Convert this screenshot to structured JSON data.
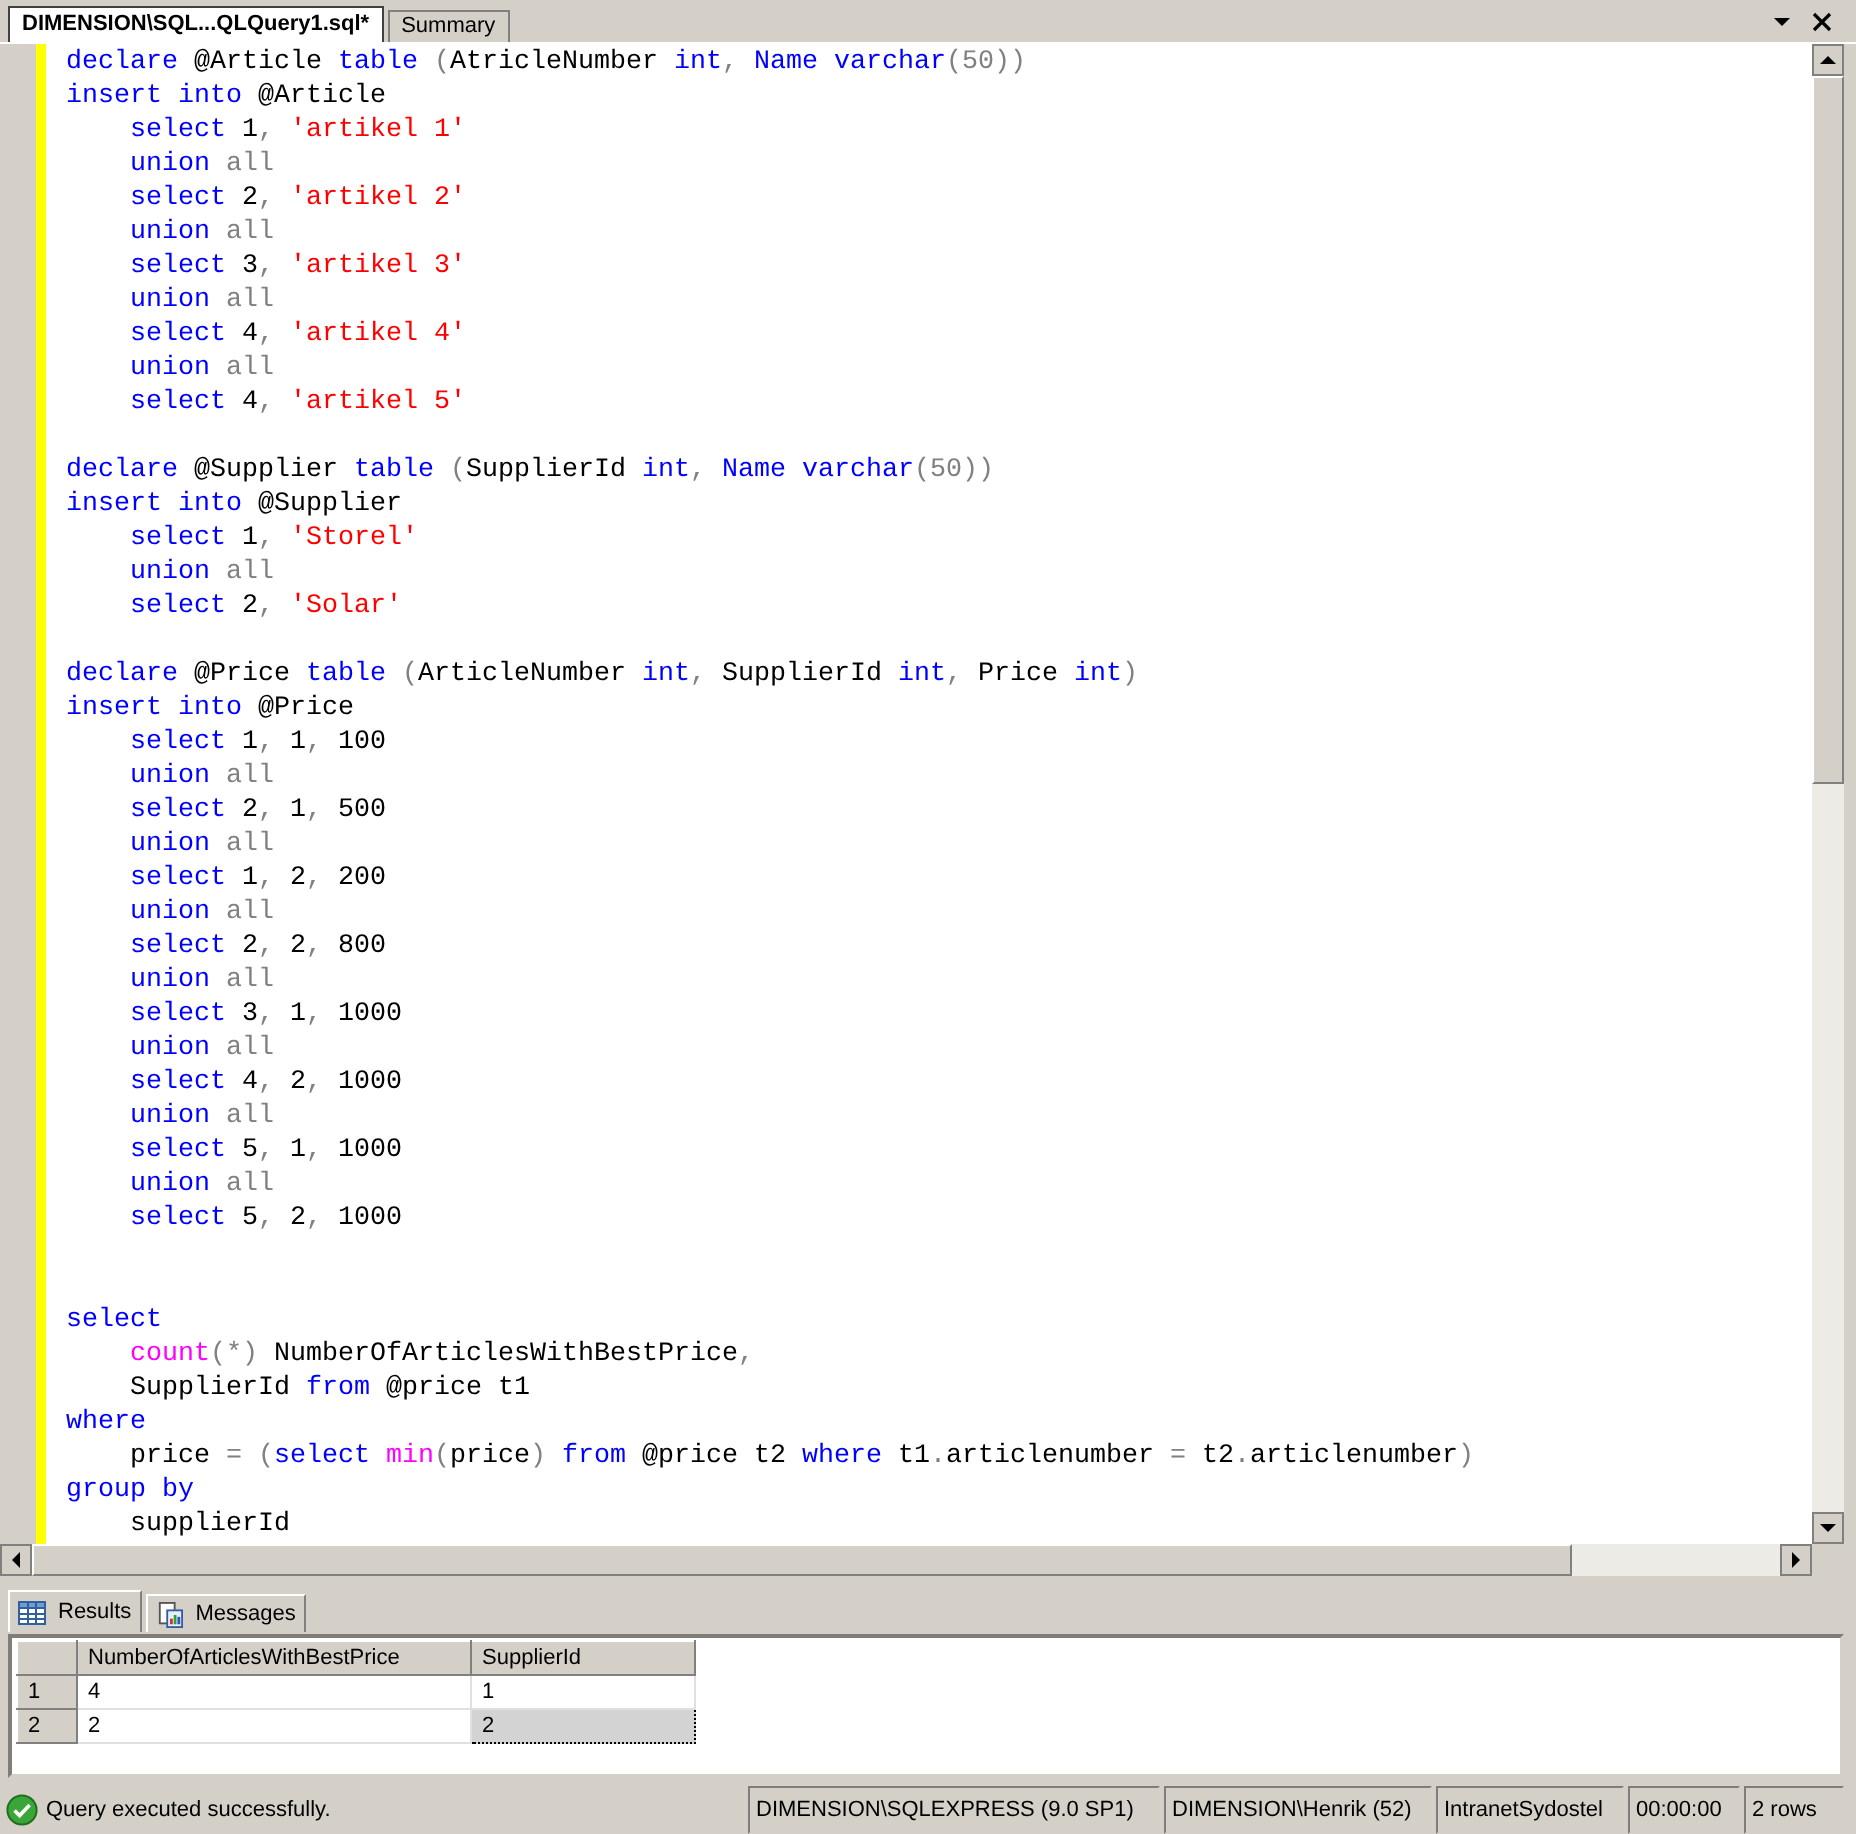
{
  "document_tabs": [
    {
      "label": "DIMENSION\\SQL...QLQuery1.sql*",
      "selected": true
    },
    {
      "label": "Summary",
      "selected": false
    }
  ],
  "editor": {
    "lines": [
      {
        "kind": "code",
        "indented": false,
        "tokens": [
          {
            "kind": "kw",
            "text": "declare "
          },
          {
            "kind": "txt",
            "text": "@Article "
          },
          {
            "kind": "kw",
            "text": "table "
          },
          {
            "kind": "op",
            "text": "("
          },
          {
            "kind": "txt",
            "text": "AtricleNumber "
          },
          {
            "kind": "kw",
            "text": "int"
          },
          {
            "kind": "op",
            "text": ", "
          },
          {
            "kind": "kw",
            "text": "Name varchar"
          },
          {
            "kind": "op",
            "text": "(50))"
          }
        ]
      },
      {
        "kind": "code",
        "indented": false,
        "tokens": [
          {
            "kind": "kw",
            "text": "insert into "
          },
          {
            "kind": "txt",
            "text": "@Article"
          }
        ]
      },
      {
        "kind": "code",
        "indented": true,
        "tokens": [
          {
            "kind": "kw",
            "text": "select "
          },
          {
            "kind": "txt",
            "text": "1"
          },
          {
            "kind": "op",
            "text": ", "
          },
          {
            "kind": "str",
            "text": "'artikel 1'"
          }
        ]
      },
      {
        "kind": "code",
        "indented": true,
        "tokens": [
          {
            "kind": "kw",
            "text": "union "
          },
          {
            "kind": "op",
            "text": "all"
          }
        ]
      },
      {
        "kind": "code",
        "indented": true,
        "tokens": [
          {
            "kind": "kw",
            "text": "select "
          },
          {
            "kind": "txt",
            "text": "2"
          },
          {
            "kind": "op",
            "text": ", "
          },
          {
            "kind": "str",
            "text": "'artikel 2'"
          }
        ]
      },
      {
        "kind": "code",
        "indented": true,
        "tokens": [
          {
            "kind": "kw",
            "text": "union "
          },
          {
            "kind": "op",
            "text": "all"
          }
        ]
      },
      {
        "kind": "code",
        "indented": true,
        "tokens": [
          {
            "kind": "kw",
            "text": "select "
          },
          {
            "kind": "txt",
            "text": "3"
          },
          {
            "kind": "op",
            "text": ", "
          },
          {
            "kind": "str",
            "text": "'artikel 3'"
          }
        ]
      },
      {
        "kind": "code",
        "indented": true,
        "tokens": [
          {
            "kind": "kw",
            "text": "union "
          },
          {
            "kind": "op",
            "text": "all"
          }
        ]
      },
      {
        "kind": "code",
        "indented": true,
        "tokens": [
          {
            "kind": "kw",
            "text": "select "
          },
          {
            "kind": "txt",
            "text": "4"
          },
          {
            "kind": "op",
            "text": ", "
          },
          {
            "kind": "str",
            "text": "'artikel 4'"
          }
        ]
      },
      {
        "kind": "code",
        "indented": true,
        "tokens": [
          {
            "kind": "kw",
            "text": "union "
          },
          {
            "kind": "op",
            "text": "all"
          }
        ]
      },
      {
        "kind": "code",
        "indented": true,
        "tokens": [
          {
            "kind": "kw",
            "text": "select "
          },
          {
            "kind": "txt",
            "text": "4"
          },
          {
            "kind": "op",
            "text": ", "
          },
          {
            "kind": "str",
            "text": "'artikel 5'"
          }
        ]
      },
      {
        "kind": "blank"
      },
      {
        "kind": "code",
        "indented": false,
        "tokens": [
          {
            "kind": "kw",
            "text": "declare "
          },
          {
            "kind": "txt",
            "text": "@Supplier "
          },
          {
            "kind": "kw",
            "text": "table "
          },
          {
            "kind": "op",
            "text": "("
          },
          {
            "kind": "txt",
            "text": "SupplierId "
          },
          {
            "kind": "kw",
            "text": "int"
          },
          {
            "kind": "op",
            "text": ", "
          },
          {
            "kind": "kw",
            "text": "Name varchar"
          },
          {
            "kind": "op",
            "text": "(50))"
          }
        ]
      },
      {
        "kind": "code",
        "indented": false,
        "tokens": [
          {
            "kind": "kw",
            "text": "insert into "
          },
          {
            "kind": "txt",
            "text": "@Supplier"
          }
        ]
      },
      {
        "kind": "code",
        "indented": true,
        "tokens": [
          {
            "kind": "kw",
            "text": "select "
          },
          {
            "kind": "txt",
            "text": "1"
          },
          {
            "kind": "op",
            "text": ", "
          },
          {
            "kind": "str",
            "text": "'Storel'"
          }
        ]
      },
      {
        "kind": "code",
        "indented": true,
        "tokens": [
          {
            "kind": "kw",
            "text": "union "
          },
          {
            "kind": "op",
            "text": "all"
          }
        ]
      },
      {
        "kind": "code",
        "indented": true,
        "tokens": [
          {
            "kind": "kw",
            "text": "select "
          },
          {
            "kind": "txt",
            "text": "2"
          },
          {
            "kind": "op",
            "text": ", "
          },
          {
            "kind": "str",
            "text": "'Solar'"
          }
        ]
      },
      {
        "kind": "blank"
      },
      {
        "kind": "code",
        "indented": false,
        "tokens": [
          {
            "kind": "kw",
            "text": "declare "
          },
          {
            "kind": "txt",
            "text": "@Price "
          },
          {
            "kind": "kw",
            "text": "table "
          },
          {
            "kind": "op",
            "text": "("
          },
          {
            "kind": "txt",
            "text": "ArticleNumber "
          },
          {
            "kind": "kw",
            "text": "int"
          },
          {
            "kind": "op",
            "text": ", "
          },
          {
            "kind": "txt",
            "text": "SupplierId "
          },
          {
            "kind": "kw",
            "text": "int"
          },
          {
            "kind": "op",
            "text": ", "
          },
          {
            "kind": "txt",
            "text": "Price "
          },
          {
            "kind": "kw",
            "text": "int"
          },
          {
            "kind": "op",
            "text": ")"
          }
        ]
      },
      {
        "kind": "code",
        "indented": false,
        "tokens": [
          {
            "kind": "kw",
            "text": "insert into "
          },
          {
            "kind": "txt",
            "text": "@Price"
          }
        ]
      },
      {
        "kind": "code",
        "indented": true,
        "tokens": [
          {
            "kind": "kw",
            "text": "select "
          },
          {
            "kind": "txt",
            "text": "1"
          },
          {
            "kind": "op",
            "text": ", "
          },
          {
            "kind": "txt",
            "text": "1"
          },
          {
            "kind": "op",
            "text": ", "
          },
          {
            "kind": "txt",
            "text": "100"
          }
        ]
      },
      {
        "kind": "code",
        "indented": true,
        "tokens": [
          {
            "kind": "kw",
            "text": "union "
          },
          {
            "kind": "op",
            "text": "all"
          }
        ]
      },
      {
        "kind": "code",
        "indented": true,
        "tokens": [
          {
            "kind": "kw",
            "text": "select "
          },
          {
            "kind": "txt",
            "text": "2"
          },
          {
            "kind": "op",
            "text": ", "
          },
          {
            "kind": "txt",
            "text": "1"
          },
          {
            "kind": "op",
            "text": ", "
          },
          {
            "kind": "txt",
            "text": "500"
          }
        ]
      },
      {
        "kind": "code",
        "indented": true,
        "tokens": [
          {
            "kind": "kw",
            "text": "union "
          },
          {
            "kind": "op",
            "text": "all"
          }
        ]
      },
      {
        "kind": "code",
        "indented": true,
        "tokens": [
          {
            "kind": "kw",
            "text": "select "
          },
          {
            "kind": "txt",
            "text": "1"
          },
          {
            "kind": "op",
            "text": ", "
          },
          {
            "kind": "txt",
            "text": "2"
          },
          {
            "kind": "op",
            "text": ", "
          },
          {
            "kind": "txt",
            "text": "200"
          }
        ]
      },
      {
        "kind": "code",
        "indented": true,
        "tokens": [
          {
            "kind": "kw",
            "text": "union "
          },
          {
            "kind": "op",
            "text": "all"
          }
        ]
      },
      {
        "kind": "code",
        "indented": true,
        "tokens": [
          {
            "kind": "kw",
            "text": "select "
          },
          {
            "kind": "txt",
            "text": "2"
          },
          {
            "kind": "op",
            "text": ", "
          },
          {
            "kind": "txt",
            "text": "2"
          },
          {
            "kind": "op",
            "text": ", "
          },
          {
            "kind": "txt",
            "text": "800"
          }
        ]
      },
      {
        "kind": "code",
        "indented": true,
        "tokens": [
          {
            "kind": "kw",
            "text": "union "
          },
          {
            "kind": "op",
            "text": "all"
          }
        ]
      },
      {
        "kind": "code",
        "indented": true,
        "tokens": [
          {
            "kind": "kw",
            "text": "select "
          },
          {
            "kind": "txt",
            "text": "3"
          },
          {
            "kind": "op",
            "text": ", "
          },
          {
            "kind": "txt",
            "text": "1"
          },
          {
            "kind": "op",
            "text": ", "
          },
          {
            "kind": "txt",
            "text": "1000"
          }
        ]
      },
      {
        "kind": "code",
        "indented": true,
        "tokens": [
          {
            "kind": "kw",
            "text": "union "
          },
          {
            "kind": "op",
            "text": "all"
          }
        ]
      },
      {
        "kind": "code",
        "indented": true,
        "tokens": [
          {
            "kind": "kw",
            "text": "select "
          },
          {
            "kind": "txt",
            "text": "4"
          },
          {
            "kind": "op",
            "text": ", "
          },
          {
            "kind": "txt",
            "text": "2"
          },
          {
            "kind": "op",
            "text": ", "
          },
          {
            "kind": "txt",
            "text": "1000"
          }
        ]
      },
      {
        "kind": "code",
        "indented": true,
        "tokens": [
          {
            "kind": "kw",
            "text": "union "
          },
          {
            "kind": "op",
            "text": "all"
          }
        ]
      },
      {
        "kind": "code",
        "indented": true,
        "tokens": [
          {
            "kind": "kw",
            "text": "select "
          },
          {
            "kind": "txt",
            "text": "5"
          },
          {
            "kind": "op",
            "text": ", "
          },
          {
            "kind": "txt",
            "text": "1"
          },
          {
            "kind": "op",
            "text": ", "
          },
          {
            "kind": "txt",
            "text": "1000"
          }
        ]
      },
      {
        "kind": "code",
        "indented": true,
        "tokens": [
          {
            "kind": "kw",
            "text": "union "
          },
          {
            "kind": "op",
            "text": "all"
          }
        ]
      },
      {
        "kind": "code",
        "indented": true,
        "tokens": [
          {
            "kind": "kw",
            "text": "select "
          },
          {
            "kind": "txt",
            "text": "5"
          },
          {
            "kind": "op",
            "text": ", "
          },
          {
            "kind": "txt",
            "text": "2"
          },
          {
            "kind": "op",
            "text": ", "
          },
          {
            "kind": "txt",
            "text": "1000"
          }
        ]
      },
      {
        "kind": "blank"
      },
      {
        "kind": "blank"
      },
      {
        "kind": "code",
        "indented": false,
        "tokens": [
          {
            "kind": "kw",
            "text": "select"
          }
        ]
      },
      {
        "kind": "code",
        "indented": true,
        "tokens": [
          {
            "kind": "fn",
            "text": "count"
          },
          {
            "kind": "op",
            "text": "(*)"
          },
          {
            "kind": "txt",
            "text": " NumberOfArticlesWithBestPrice"
          },
          {
            "kind": "op",
            "text": ","
          }
        ]
      },
      {
        "kind": "code",
        "indented": true,
        "tokens": [
          {
            "kind": "txt",
            "text": "SupplierId "
          },
          {
            "kind": "kw",
            "text": "from "
          },
          {
            "kind": "txt",
            "text": "@price t1"
          }
        ]
      },
      {
        "kind": "code",
        "indented": false,
        "tokens": [
          {
            "kind": "kw",
            "text": "where"
          }
        ]
      },
      {
        "kind": "code",
        "indented": true,
        "tokens": [
          {
            "kind": "txt",
            "text": "price "
          },
          {
            "kind": "op",
            "text": "= ("
          },
          {
            "kind": "kw",
            "text": "select "
          },
          {
            "kind": "fn",
            "text": "min"
          },
          {
            "kind": "op",
            "text": "("
          },
          {
            "kind": "txt",
            "text": "price"
          },
          {
            "kind": "op",
            "text": ") "
          },
          {
            "kind": "kw",
            "text": "from "
          },
          {
            "kind": "txt",
            "text": "@price t2 "
          },
          {
            "kind": "kw",
            "text": "where "
          },
          {
            "kind": "txt",
            "text": "t1"
          },
          {
            "kind": "op",
            "text": "."
          },
          {
            "kind": "txt",
            "text": "articlenumber "
          },
          {
            "kind": "op",
            "text": "= "
          },
          {
            "kind": "txt",
            "text": "t2"
          },
          {
            "kind": "op",
            "text": "."
          },
          {
            "kind": "txt",
            "text": "articlenumber"
          },
          {
            "kind": "op",
            "text": ")"
          }
        ]
      },
      {
        "kind": "code",
        "indented": false,
        "tokens": [
          {
            "kind": "kw",
            "text": "group by"
          }
        ]
      },
      {
        "kind": "code",
        "indented": true,
        "tokens": [
          {
            "kind": "txt",
            "text": "supplierId"
          }
        ]
      }
    ]
  },
  "result_tabs": [
    {
      "label": "Results",
      "selected": true
    },
    {
      "label": "Messages",
      "selected": false
    }
  ],
  "results_grid": {
    "columns": [
      "NumberOfArticlesWithBestPrice",
      "SupplierId"
    ],
    "rows": [
      {
        "number": "1",
        "cells": [
          {
            "text": "4",
            "selected": false
          },
          {
            "text": "1",
            "selected": false
          }
        ]
      },
      {
        "number": "2",
        "cells": [
          {
            "text": "2",
            "selected": false
          },
          {
            "text": "2",
            "selected": true
          }
        ]
      }
    ]
  },
  "status_bar": {
    "message": "Query executed successfully.",
    "server": "DIMENSION\\SQLEXPRESS (9.0 SP1)",
    "user": "DIMENSION\\Henrik (52)",
    "database": "IntranetSydostel",
    "elapsed": "00:00:00",
    "row_count": "2 rows"
  }
}
